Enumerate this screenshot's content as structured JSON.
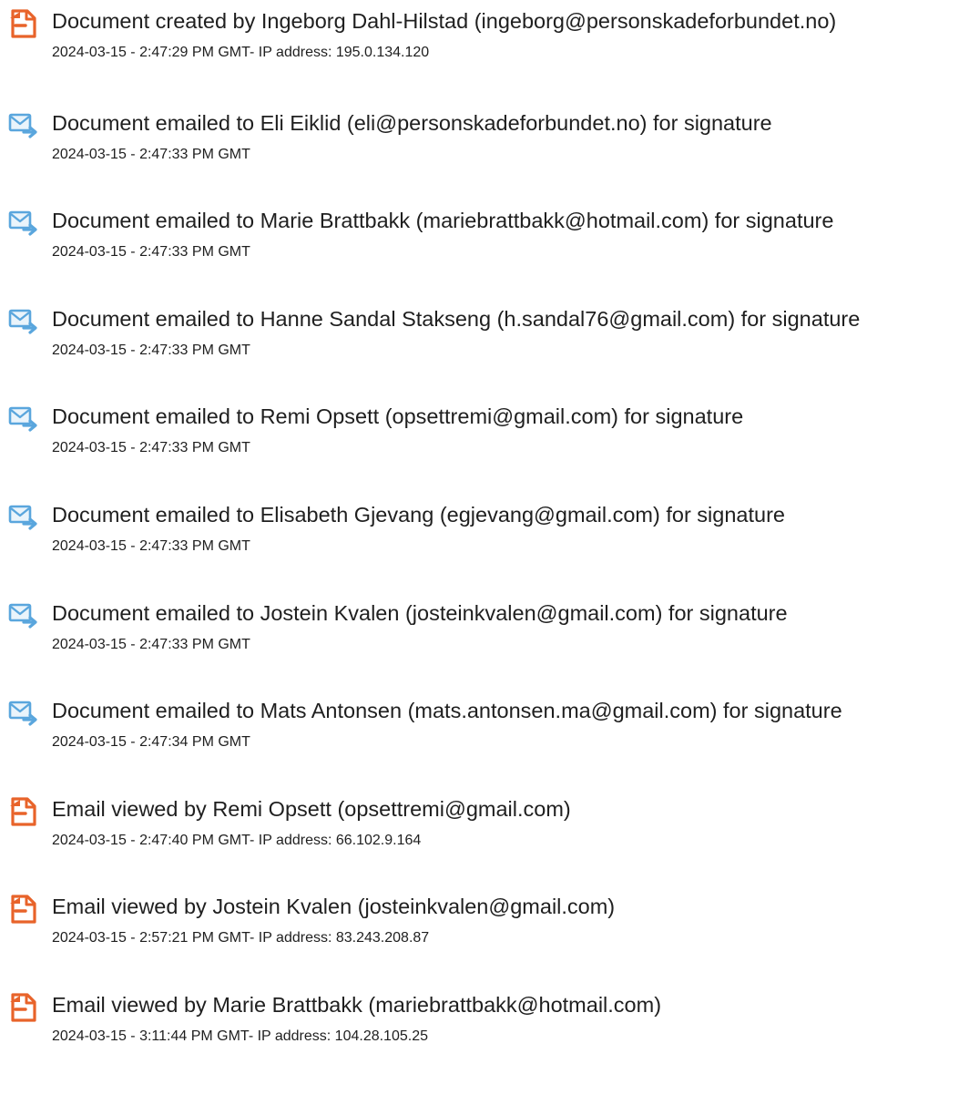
{
  "colors": {
    "doc_icon": "#e8632a",
    "mail_icon": "#5aa6dd"
  },
  "events": [
    {
      "icon": "document-icon",
      "title": "Document created by Ingeborg Dahl-Hilstad (ingeborg@personskadeforbundet.no)",
      "meta": "2024-03-15 - 2:47:29 PM GMT- IP address: 195.0.134.120"
    },
    {
      "icon": "email-sent-icon",
      "title": "Document emailed to Eli Eiklid (eli@personskadeforbundet.no) for signature",
      "meta": "2024-03-15 - 2:47:33 PM GMT"
    },
    {
      "icon": "email-sent-icon",
      "title": "Document emailed to Marie Brattbakk (mariebrattbakk@hotmail.com) for signature",
      "meta": "2024-03-15 - 2:47:33 PM GMT"
    },
    {
      "icon": "email-sent-icon",
      "title": "Document emailed to Hanne Sandal Stakseng (h.sandal76@gmail.com) for signature",
      "meta": "2024-03-15 - 2:47:33 PM GMT"
    },
    {
      "icon": "email-sent-icon",
      "title": "Document emailed to Remi Opsett (opsettremi@gmail.com) for signature",
      "meta": "2024-03-15 - 2:47:33 PM GMT"
    },
    {
      "icon": "email-sent-icon",
      "title": "Document emailed to Elisabeth Gjevang (egjevang@gmail.com) for signature",
      "meta": "2024-03-15 - 2:47:33 PM GMT"
    },
    {
      "icon": "email-sent-icon",
      "title": "Document emailed to Jostein Kvalen (josteinkvalen@gmail.com) for signature",
      "meta": "2024-03-15 - 2:47:33 PM GMT"
    },
    {
      "icon": "email-sent-icon",
      "title": "Document emailed to Mats Antonsen (mats.antonsen.ma@gmail.com) for signature",
      "meta": "2024-03-15 - 2:47:34 PM GMT"
    },
    {
      "icon": "document-icon",
      "title": "Email viewed by Remi Opsett (opsettremi@gmail.com)",
      "meta": "2024-03-15 - 2:47:40 PM GMT- IP address: 66.102.9.164"
    },
    {
      "icon": "document-icon",
      "title": "Email viewed by Jostein Kvalen (josteinkvalen@gmail.com)",
      "meta": "2024-03-15 - 2:57:21 PM GMT- IP address: 83.243.208.87"
    },
    {
      "icon": "document-icon",
      "title": "Email viewed by Marie Brattbakk (mariebrattbakk@hotmail.com)",
      "meta": "2024-03-15 - 3:11:44 PM GMT- IP address: 104.28.105.25"
    }
  ]
}
